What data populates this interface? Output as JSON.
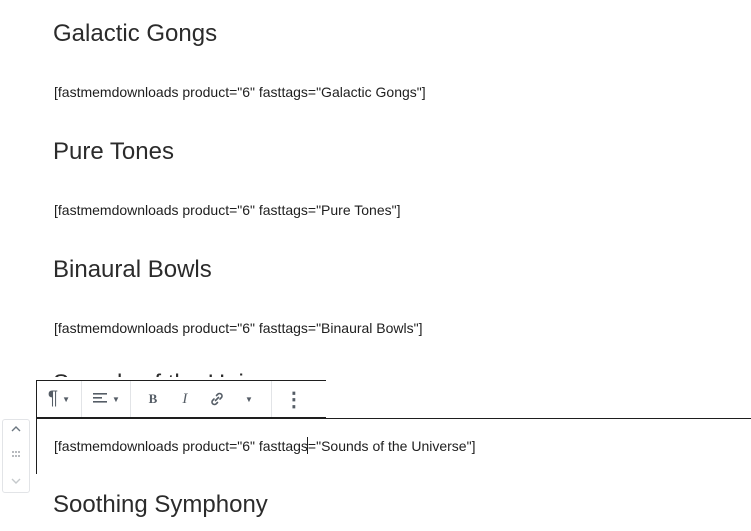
{
  "blocks": [
    {
      "heading": "Galactic Gongs",
      "shortcode": "[fastmemdownloads product=\"6\" fasttags=\"Galactic Gongs\"]"
    },
    {
      "heading": "Pure Tones",
      "shortcode": "[fastmemdownloads product=\"6\" fasttags=\"Pure Tones\"]"
    },
    {
      "heading": "Binaural Bowls",
      "shortcode": "[fastmemdownloads product=\"6\" fasttags=\"Binaural Bowls\"]"
    },
    {
      "heading": "Sounds of the Universe",
      "shortcode_before_caret": "[fastmemdownloads product=\"6\" fasttags",
      "shortcode_after_caret": "=\"Sounds of the Universe\"]"
    },
    {
      "heading": "Soothing Symphony"
    }
  ],
  "toolbar": {
    "paragraph_icon": "¶",
    "align_icon": "align-left-icon",
    "bold_label": "B",
    "italic_label": "I",
    "link_icon": "link-icon",
    "more_icon": "⋮"
  },
  "mover": {
    "up_icon": "chevron-up-icon",
    "drag_icon": "drag-handle-icon",
    "down_icon": "chevron-down-icon"
  }
}
